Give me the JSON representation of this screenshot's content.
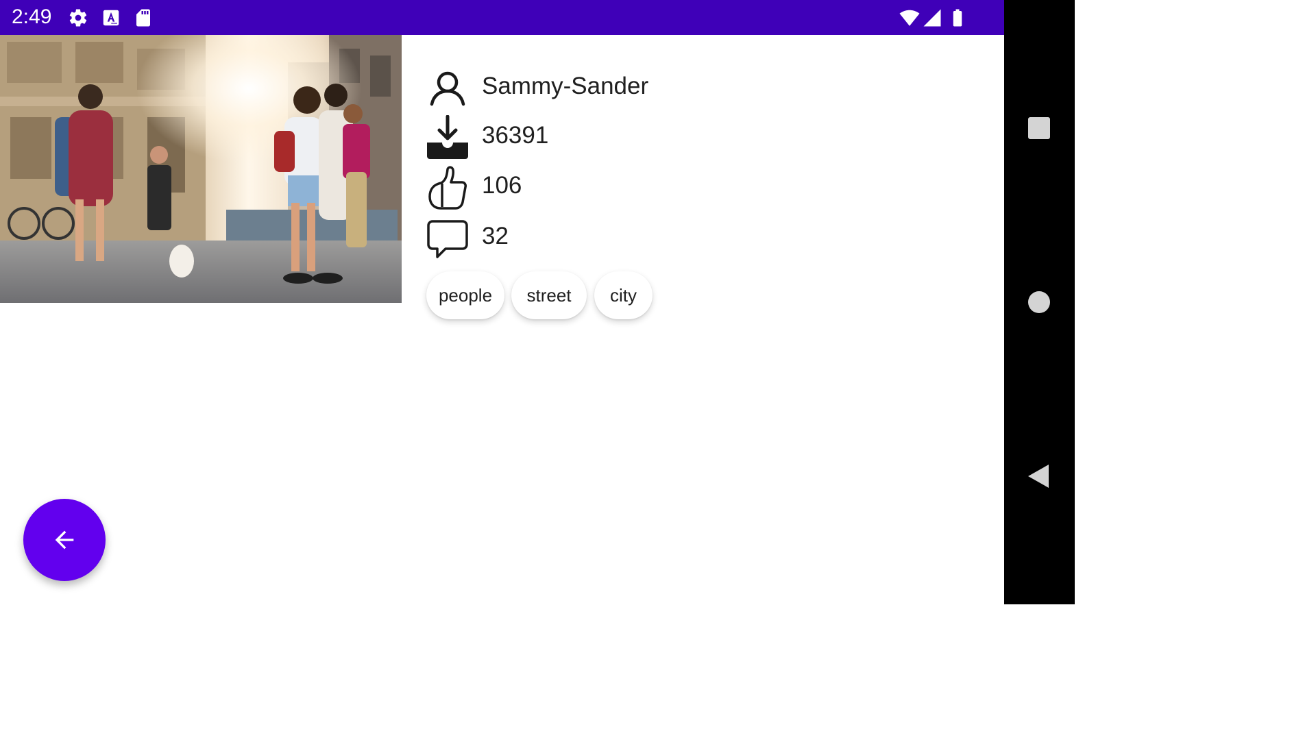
{
  "status_bar": {
    "time": "2:49",
    "left_icons": [
      "gear-icon",
      "a-font-icon",
      "sd-card-icon"
    ],
    "right_icons": [
      "wifi-icon",
      "signal-icon",
      "battery-icon"
    ],
    "background_color": "#3f00b8"
  },
  "photo": {
    "icon": "street-photo"
  },
  "details": {
    "user": {
      "icon": "user-icon",
      "value": "Sammy-Sander"
    },
    "downloads": {
      "icon": "download-icon",
      "value": "36391"
    },
    "likes": {
      "icon": "thumbs-up-icon",
      "value": "106"
    },
    "comments": {
      "icon": "comment-icon",
      "value": "32"
    }
  },
  "tags": [
    "people",
    "street",
    "city"
  ],
  "fab": {
    "icon": "arrow-back-icon",
    "color": "#6200ee"
  },
  "nav_bar": {
    "buttons": [
      "recents-icon",
      "home-icon",
      "back-icon"
    ]
  }
}
